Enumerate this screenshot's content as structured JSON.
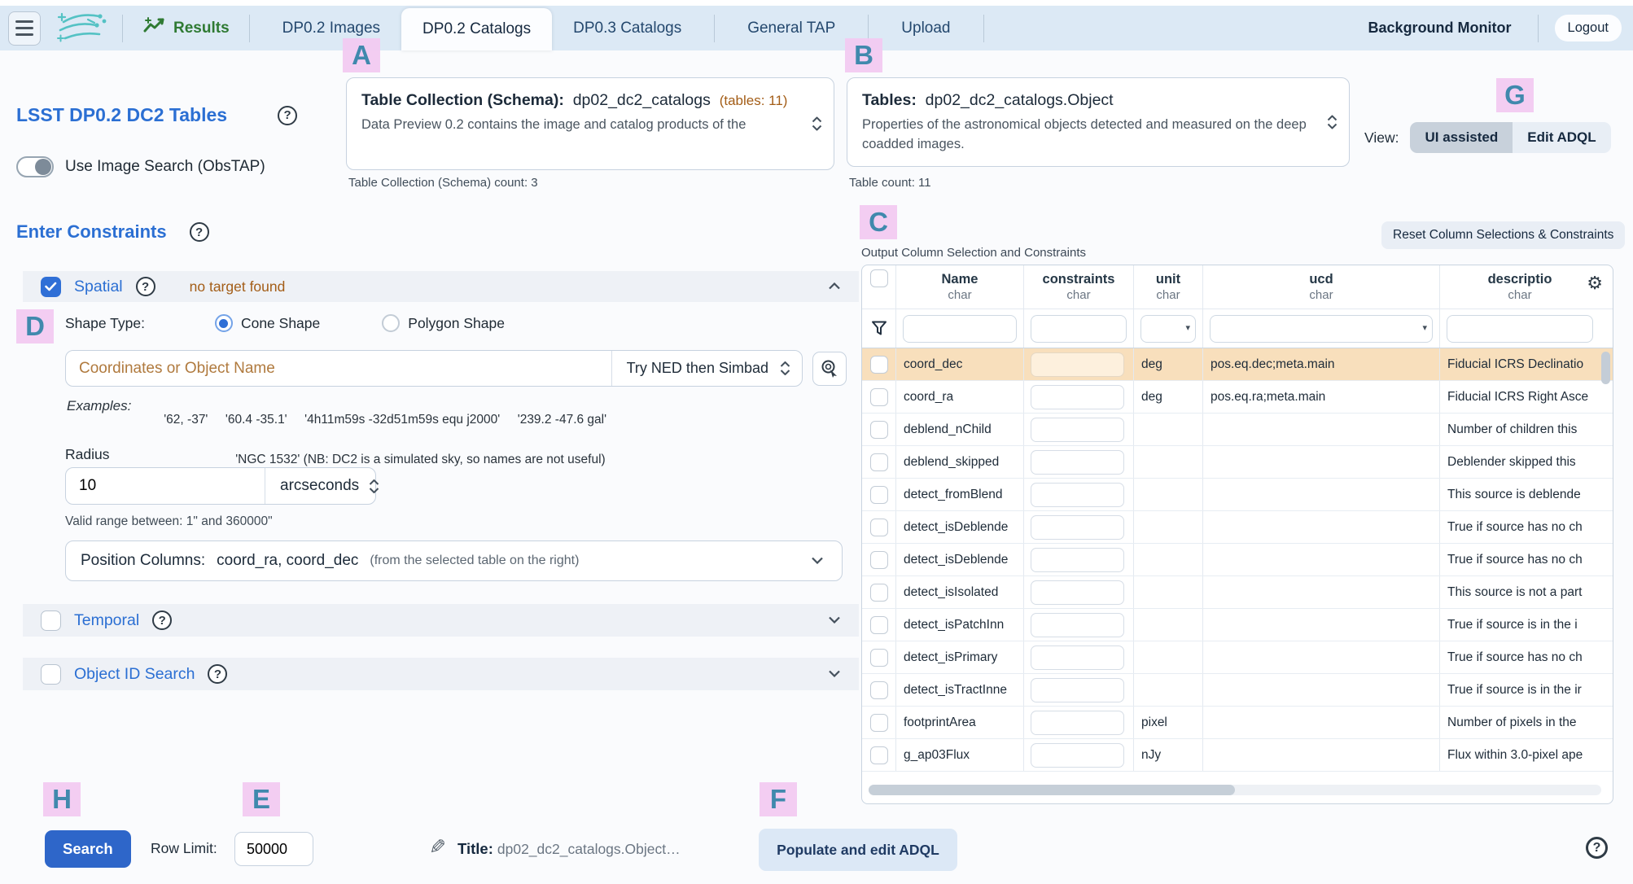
{
  "colors": {
    "nav_background": "#dce9f5",
    "accent_blue": "#2b6fd3",
    "primary_button": "#2e66c9",
    "warning_orange": "#a35d17",
    "row_highlight": "#f8dfbc",
    "marker_pink": "#f2c9f1",
    "marker_letter": "#4089ad",
    "results_green": "#2f7a33"
  },
  "nav": {
    "results_label": "Results",
    "tabs": [
      {
        "label": "DP0.2 Images"
      },
      {
        "label": "DP0.2 Catalogs"
      },
      {
        "label": "DP0.3 Catalogs"
      },
      {
        "label": "General TAP"
      },
      {
        "label": "Upload"
      }
    ],
    "active_tab": "DP0.2 Catalogs",
    "background_monitor_label": "Background Monitor",
    "logout_label": "Logout"
  },
  "schema_section": {
    "heading": "LSST DP0.2 DC2 Tables",
    "obstap_toggle_label": "Use Image Search (ObsTAP)",
    "schema_select": {
      "label": "Table Collection (Schema):",
      "value": "dp02_dc2_catalogs",
      "tables_note": "(tables: 11)",
      "description": "Data Preview 0.2 contains the image and catalog products of the",
      "count_label": "Table Collection (Schema) count: 3"
    },
    "table_select": {
      "label": "Tables:",
      "value": "dp02_dc2_catalogs.Object",
      "description": "Properties of the astronomical objects detected and measured on the deep coadded images.",
      "count_label": "Table count: 11"
    },
    "view": {
      "label": "View:",
      "option_ui": "UI assisted",
      "option_adql": "Edit ADQL",
      "selected": "UI assisted"
    }
  },
  "constraints": {
    "heading": "Enter Constraints",
    "spatial": {
      "label": "Spatial",
      "checked": true,
      "status": "no target found",
      "shape_type_label": "Shape Type:",
      "shape_cone": "Cone Shape",
      "shape_polygon": "Polygon Shape",
      "selected_shape": "Cone Shape",
      "coords_placeholder": "Coordinates or Object Name",
      "resolver": "Try NED then Simbad",
      "examples_label": "Examples:",
      "examples_line1": "'62, -37'     '60.4 -35.1'     '4h11m59s -32d51m59s equ j2000'     '239.2 -47.6 gal'",
      "examples_line2": "'NGC 1532' (NB: DC2 is a simulated sky, so names are not useful)",
      "radius_label": "Radius",
      "radius_value": "10",
      "radius_unit": "arcseconds",
      "radius_hint": "Valid range between: 1\" and 360000\"",
      "position_columns_label": "Position Columns:",
      "position_columns_value": "coord_ra, coord_dec",
      "position_columns_note": "(from the selected table on the right)"
    },
    "temporal": {
      "label": "Temporal",
      "checked": false
    },
    "object_id": {
      "label": "Object ID Search",
      "checked": false
    }
  },
  "columns_panel": {
    "reset_button": "Reset Column Selections & Constraints",
    "caption": "Output Column Selection and Constraints",
    "headers": {
      "name": {
        "name": "Name",
        "type": "char"
      },
      "constraints": {
        "name": "constraints",
        "type": "char"
      },
      "unit": {
        "name": "unit",
        "type": "char"
      },
      "ucd": {
        "name": "ucd",
        "type": "char"
      },
      "description": {
        "name": "descriptio",
        "type": "char"
      }
    },
    "rows": [
      {
        "name": "coord_dec",
        "unit": "deg",
        "ucd": "pos.eq.dec;meta.main",
        "description": "Fiducial ICRS Declinatio"
      },
      {
        "name": "coord_ra",
        "unit": "deg",
        "ucd": "pos.eq.ra;meta.main",
        "description": "Fiducial ICRS Right Asce"
      },
      {
        "name": "deblend_nChild",
        "unit": "",
        "ucd": "",
        "description": "Number of children this"
      },
      {
        "name": "deblend_skipped",
        "unit": "",
        "ucd": "",
        "description": "Deblender skipped this"
      },
      {
        "name": "detect_fromBlend",
        "unit": "",
        "ucd": "",
        "description": "This source is deblende"
      },
      {
        "name": "detect_isDeblende",
        "unit": "",
        "ucd": "",
        "description": "True if source has no ch"
      },
      {
        "name": "detect_isDeblende",
        "unit": "",
        "ucd": "",
        "description": "True if source has no ch"
      },
      {
        "name": "detect_isIsolated",
        "unit": "",
        "ucd": "",
        "description": "This source is not a part"
      },
      {
        "name": "detect_isPatchInn",
        "unit": "",
        "ucd": "",
        "description": "True if source is in the i"
      },
      {
        "name": "detect_isPrimary",
        "unit": "",
        "ucd": "",
        "description": "True if source has no ch"
      },
      {
        "name": "detect_isTractInne",
        "unit": "",
        "ucd": "",
        "description": "True if source is in the ir"
      },
      {
        "name": "footprintArea",
        "unit": "pixel",
        "ucd": "",
        "description": "Number of pixels in the"
      },
      {
        "name": "g_ap03Flux",
        "unit": "nJy",
        "ucd": "",
        "description": "Flux within 3.0-pixel ape"
      }
    ]
  },
  "footer": {
    "search_button": "Search",
    "row_limit_label": "Row Limit:",
    "row_limit_value": "50000",
    "title_label": "Title:",
    "title_value": "dp02_dc2_catalogs.Object…",
    "populate_button": "Populate and edit ADQL"
  },
  "markers": {
    "a": "A",
    "b": "B",
    "c": "C",
    "d": "D",
    "e": "E",
    "f": "F",
    "g": "G",
    "h": "H"
  }
}
